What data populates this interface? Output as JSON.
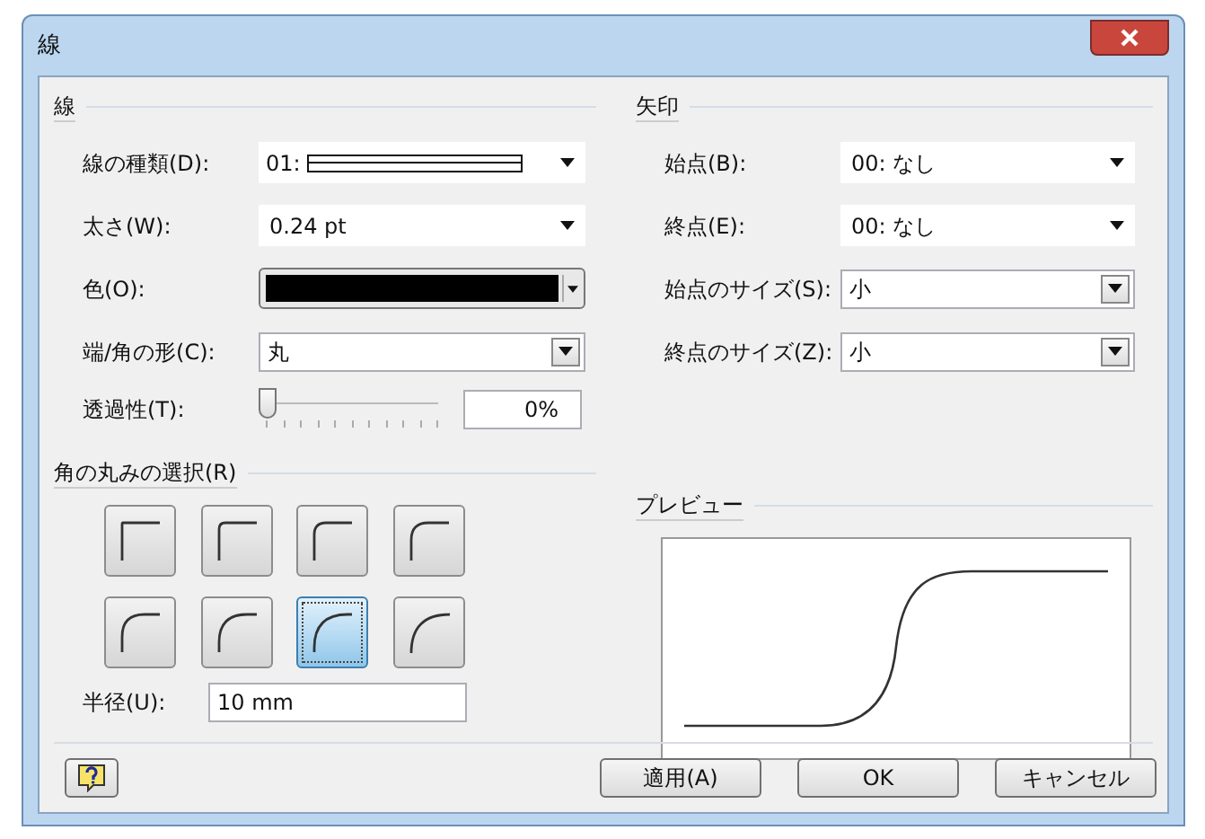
{
  "window": {
    "title": "線"
  },
  "line_section": {
    "title": "線",
    "fields": [
      {
        "label": "線の種類(D):",
        "kind": "linetype",
        "value": "01:"
      },
      {
        "label": "太さ(W):",
        "kind": "dropdown",
        "value": "0.24 pt"
      },
      {
        "label": "色(O):",
        "kind": "color",
        "color": "#000000"
      },
      {
        "label": "端/角の形(C):",
        "kind": "combo",
        "value": "丸"
      }
    ],
    "transparency": {
      "label": "透過性(T):",
      "level": 0,
      "value": "0%"
    }
  },
  "arrow_section": {
    "title": "矢印",
    "fields": [
      {
        "label": "始点(B):",
        "kind": "dropdown",
        "value": "00: なし"
      },
      {
        "label": "終点(E):",
        "kind": "dropdown",
        "value": "00: なし"
      },
      {
        "label": "始点のサイズ(S):",
        "kind": "combo",
        "value": "小"
      },
      {
        "label": "終点のサイズ(Z):",
        "kind": "combo",
        "value": "小"
      }
    ]
  },
  "corner_section": {
    "title": "角の丸みの選択(R)",
    "options": [
      {
        "selected": false
      },
      {
        "selected": false
      },
      {
        "selected": false
      },
      {
        "selected": false
      },
      {
        "selected": false
      },
      {
        "selected": false
      },
      {
        "selected": true
      },
      {
        "selected": false
      }
    ],
    "radius": {
      "label": "半径(U):",
      "value": "10 mm"
    }
  },
  "preview_section": {
    "title": "プレビュー"
  },
  "buttons": [
    {
      "label": "適用(A)"
    },
    {
      "label": "OK"
    },
    {
      "label": "キャンセル"
    }
  ]
}
